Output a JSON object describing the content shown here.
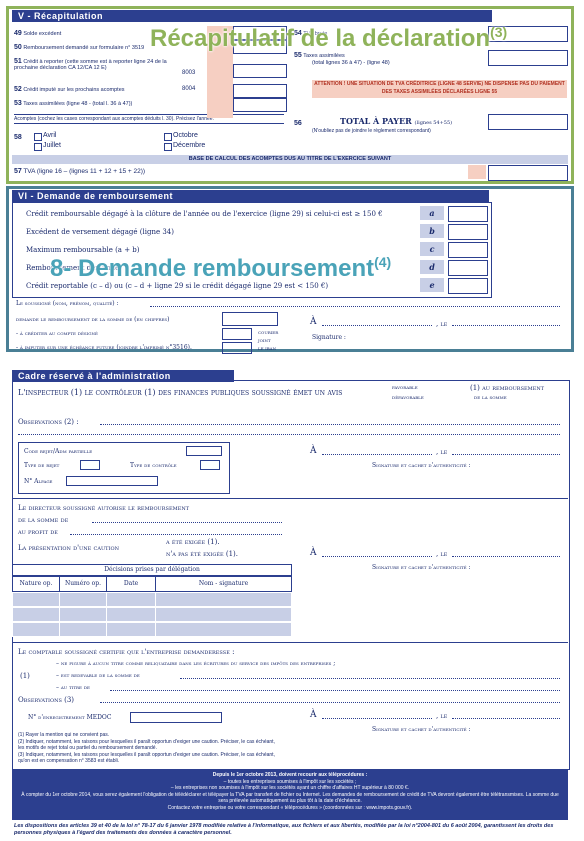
{
  "section5": {
    "header": "V - Récapitulation",
    "overlay_title": "Récapitulatif de la déclaration",
    "overlay_sup": "(3)",
    "line49": "Solde excédent",
    "line50": "Remboursement demandé sur formulaire n° 3519",
    "line51": "Crédit à reporter (cette somme est à reporter ligne 24 de la prochaine déclaration CA 12/CA 12 E)",
    "code51": "8003",
    "line52": "Crédit imputé sur les prochains acomptes",
    "code52": "8004",
    "line53": "Taxes assimilées (ligne 48 - (total l. 36 à 47))",
    "acomptes_note": "Acomptes (cochez les cases correspondant aux acomptes déduits l. 30). Précisez l'année.",
    "n54": "54",
    "label54": "TVA brute",
    "n55": "55",
    "label55": "Taxes assimilées",
    "label55b": "(total lignes 36 à 47) - (ligne 48)",
    "warning": "ATTENTION ! UNE SITUATION DE TVA CRÉDITRICE (LIGNE 48 SERVIE) NE DISPENSE PAS DU PAIEMENT DES TAXES ASSIMILÉES DÉCLARÉES LIGNE 55",
    "n56": "56",
    "total_label": "TOTAL À PAYER",
    "total_sub": "(lignes 54+55)",
    "n56_note": "(N'oubliez pas de joindre le règlement correspondant)",
    "n58": "58",
    "avril": "Avril",
    "juillet": "Juillet",
    "octobre": "Octobre",
    "decembre": "Décembre",
    "base_calc": "BASE DE CALCUL DES ACOMPTES DUS AU TITRE DE L'EXERCICE SUIVANT",
    "n57": "57",
    "line57": "TVA (ligne 16 – (lignes 11 + 12 + 15 + 22))"
  },
  "section6": {
    "header": "VI - Demande de remboursement",
    "overlay_title": "8- Demande remboursement",
    "overlay_sup": "(4)",
    "rows": [
      {
        "text": "Crédit remboursable dégagé à la clôture de l'année ou de l'exercice (ligne 29) si celui-ci est ≥ 150 €",
        "letter": "a"
      },
      {
        "text": "Excédent de versement dégagé (ligne 34)",
        "letter": "b"
      },
      {
        "text": "Maximum remboursable (a + b)",
        "letter": "c"
      },
      {
        "text": "Remboursement demandé",
        "letter": "d"
      },
      {
        "text": "Crédit reportable (c – d) ou (c – d + ligne 29 si le crédit dégagé ligne 29 est < 150 €)",
        "letter": "e"
      }
    ],
    "soussigne": "Le soussigné (nom, prénom, qualité) :",
    "demande": "demande le remboursement de la somme de (en chiffres)",
    "crediter": "- à créditer au compte désigné",
    "imputer": "- à imputer sur une échéance future (joindre l'imprimé n°3516).",
    "courier": "courier",
    "joint": "joint",
    "le_iban": "le iban",
    "a": "À",
    "le": ", le",
    "signature": "Signature :"
  },
  "admin": {
    "header": "Cadre réservé à l'administration",
    "inspecteur": "L'inspecteur (1)   le contrôleur (1) des finances publiques soussigné émet un avis",
    "favorable": "favorable",
    "defavorable": "défavorable",
    "au_remb": "(1) au remboursement",
    "de_la_somme": "de la somme",
    "observations": "Observations (2) :",
    "code_rejet": "Code rejet/Adm partielle",
    "type_rejet": "Type de rejet",
    "type_controle": "Type de contrôle",
    "alpage": "N° Alpage",
    "a": "À",
    "le": ", le",
    "sig_cachet": "Signature et cachet d'authenticité :",
    "directeur": "Le directeur soussigné autorise le remboursement",
    "de_la_somme2": "de la somme de",
    "au_profit": "au profit de",
    "caution": "La présentation d'une caution",
    "exigee": "a été exigée (1).",
    "non_exigee": "n'a pas été exigée (1).",
    "decisions": "Décisions prises par délégation",
    "cols": [
      "Nature op.",
      "Numéro op.",
      "Date",
      "Nom - signature"
    ],
    "comptable": "Le comptable soussigné certifie que l'entreprise demanderesse :",
    "c1": "– ne figure à aucun titre comme reliquataire dans les écritures du service des impôts des entreprises ;",
    "c2": "– est redevable de la somme de",
    "c3": "– au titre de",
    "obs3": "Observations (3)",
    "enreg": "N° d'enregistrement MEDOC",
    "n1": "(1)",
    "notes": [
      "(1) Rayer la mention qui ne convient pas.",
      "(2) Indiquer, notamment, les raisons pour lesquelles il paraît opportun d'exiger une caution. Préciser, le cas échéant, les motifs de rejet total ou partiel du remboursement demandé.",
      "(3) Indiquer, notamment, les raisons pour lesquelles il paraît opportun d'exiger une caution. Préciser, le cas échéant, qu'on est en compensation n° 3583 est établi."
    ]
  },
  "footer": {
    "lines": [
      "Depuis le 1er octobre 2013, doivent recourir aux téléprocédures :",
      "– toutes les entreprises soumises à l'impôt sur les sociétés ;",
      "– les entreprises non soumises à l'impôt sur les sociétés ayant un chiffre d'affaires HT supérieur à 80 000 €.",
      "À compter du 1er octobre 2014, vous serez également l'obligation de télédéclarer et télépayer la TVA par transfert de fichier ou Internet. Les demandes de remboursement de crédit de TVA devront également être télétransmises. La somme due sera prélevée automatiquement au plus tôt à la date d'échéance.",
      "Contactez votre entreprise ou votre correspondant « téléprocédures » (coordonnées sur : www.impots.gouv.fr)."
    ],
    "legal": "Les dispositions des articles 39 et 40 de la loi n° 78-17 du 6 janvier 1978 modifiée relative à l'informatique, aux fichiers et aux libertés, modifiée par la loi n°2004-801 du 6 août 2004, garantissent les droits des personnes physiques à l'égard des traitements des données à caractère personnel."
  },
  "colors": {
    "navy": "#2c3f8f",
    "green_frame": "#8fb35a",
    "teal_frame": "#4a7f95",
    "pink": "#f6cfc2",
    "cell_blue": "#c8cfe6"
  }
}
